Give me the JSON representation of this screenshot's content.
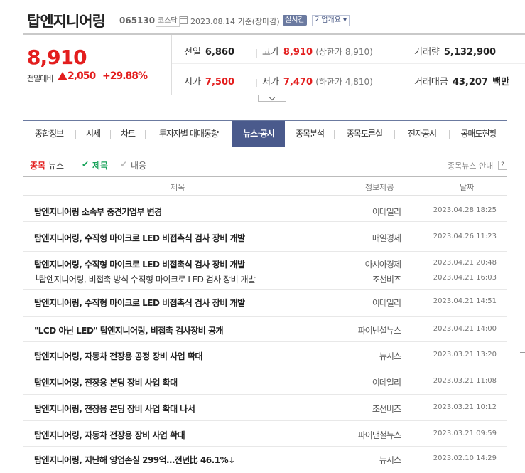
{
  "header": {
    "company_name": "탑엔지니어링",
    "stock_code": "065130",
    "market": "코스닥",
    "date_text": "2023.08.14 기준(장마감)",
    "live_label": "실시간",
    "overview_label": "기업개요"
  },
  "quote": {
    "price": "8,910",
    "change_label": "전일대비",
    "change": "2,050",
    "change_pct": "+29.88%",
    "prev_close_label": "전일",
    "prev_close": "6,860",
    "high_label": "고가",
    "high": "8,910",
    "upper_limit_label": "(상한가",
    "upper_limit": "8,910)",
    "volume_label": "거래량",
    "volume": "5,132,900",
    "open_label": "시가",
    "open": "7,500",
    "low_label": "저가",
    "low": "7,470",
    "lower_limit_label": "(하한가",
    "lower_limit": "4,810)",
    "amount_label": "거래대금",
    "amount": "43,207",
    "amount_unit": "백만",
    "up_color": "#e31e1e"
  },
  "tabs": [
    {
      "label": "종합정보"
    },
    {
      "label": "시세"
    },
    {
      "label": "차트"
    },
    {
      "label": "투자자별 매매동향"
    },
    {
      "label": "뉴스·공시"
    },
    {
      "label": "종목분석"
    },
    {
      "label": "종목토론실"
    },
    {
      "label": "전자공시"
    },
    {
      "label": "공매도현황"
    }
  ],
  "filters": {
    "news_label_1": "종목",
    "news_label_2": "뉴스",
    "title_check": "✔",
    "title_label": "제목",
    "content_check": "✔",
    "content_label": "내용",
    "guide_label": "종목뉴스 안내",
    "help": "?"
  },
  "table": {
    "headers": {
      "title": "제목",
      "provider": "정보제공",
      "date": "날짜"
    },
    "rows": [
      {
        "title": "탑엔지니어링 소속부 중견기업부 변경",
        "provider": "이데일리",
        "date": "2023.04.28 18:25"
      },
      {
        "title": "탑엔지니어링, 수직형 마이크로 LED 비접촉식 검사 장비 개발",
        "provider": "매일경제",
        "date": "2023.04.26 11:23"
      },
      {
        "title": "탑엔지니어링, 수직형 마이크로 LED 비접촉식 검사 장비 개발",
        "provider": "아시아경제",
        "date": "2023.04.21 20:48",
        "sub_title": "└탑엔지니어링, 비접촉 방식 수직형 마이크로 LED 검사 장비 개발",
        "sub_provider": "조선비즈",
        "sub_date": "2023.04.21 16:03"
      },
      {
        "title": "탑엔지니어링, 수직형 마이크로 LED 비접촉식 검사 장비 개발",
        "provider": "이데일리",
        "date": "2023.04.21 14:51"
      },
      {
        "title": "\"LCD 아닌 LED\" 탑엔지니어링, 비접촉 검사장비 공개",
        "provider": "파이낸셜뉴스",
        "date": "2023.04.21 14:00"
      },
      {
        "title": "탑엔지니어링, 자동차 전장용 공정 장비 사업 확대",
        "provider": "뉴시스",
        "date": "2023.03.21 13:20"
      },
      {
        "title": "탑엔지니어링, 전장용 본딩 장비 사업 확대",
        "provider": "이데일리",
        "date": "2023.03.21 11:08"
      },
      {
        "title": "탑엔지니어링, 전장용 본딩 장비 사업 확대 나서",
        "provider": "조선비즈",
        "date": "2023.03.21 10:12"
      },
      {
        "title": "탑엔지니어링, 자동차 전장용 장비 사업 확대",
        "provider": "파이낸셜뉴스",
        "date": "2023.03.21 09:59"
      },
      {
        "title": "탑엔지니어링, 지난해 영업손실 299억…전년比 46.1%↓",
        "provider": "뉴시스",
        "date": "2023.02.10 14:29"
      }
    ]
  }
}
